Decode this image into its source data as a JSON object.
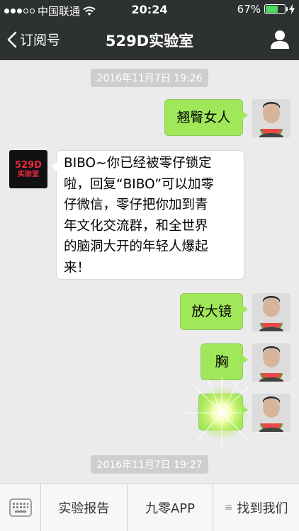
{
  "status_bar": {
    "carrier": "中国联通",
    "time": "20:24",
    "battery_pct": "67%",
    "battery_level": 0.67,
    "signal_dots_filled": 3,
    "signal_dots_total": 5
  },
  "nav": {
    "back_label": "订阅号",
    "title": "529D实验室"
  },
  "chat": {
    "timestamp_top": "2016年11月7日 19:26",
    "timestamp_bottom": "2016年11月7日 19:27",
    "messages": [
      {
        "side": "right",
        "text": "翘臀女人"
      },
      {
        "side": "left",
        "text_lines": [
          "BIBO~你已经被零仔锁定",
          "啦，回复“BIBO”可以加零",
          "仔微信，零仔把你加到青",
          "年文化交流群，和全世界",
          "的脑洞大开的年轻人爆起",
          "来！"
        ]
      },
      {
        "side": "right",
        "text": "放大镜"
      },
      {
        "side": "right",
        "text": "胸"
      },
      {
        "side": "right",
        "text": ""
      }
    ],
    "brand_logo_text": "529D",
    "brand_logo_sub": "实验室"
  },
  "bottom_menu": {
    "items": [
      "实验报告",
      "九零APP",
      "找到我们"
    ]
  },
  "colors": {
    "header_bg": "#2e3132",
    "bubble_green": "#a0e75a",
    "chat_bg": "#ebebeb",
    "logo_red": "#e8283c"
  }
}
